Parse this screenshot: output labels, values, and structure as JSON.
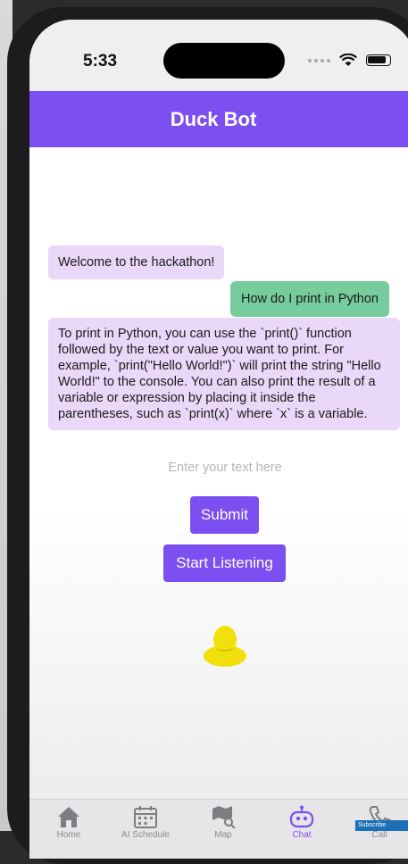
{
  "statusbar": {
    "time": "5:33"
  },
  "header": {
    "title": "Duck Bot"
  },
  "colors": {
    "accent": "#7b4ff0",
    "bot_bubble": "#e9d8f7",
    "user_bubble": "#76cc9c"
  },
  "messages": [
    {
      "role": "bot",
      "text": "Welcome to the hackathon!"
    },
    {
      "role": "user",
      "text": "How do I print in Python"
    },
    {
      "role": "bot",
      "text": "To print in Python, you can use the `print()` function followed by the text or value you want to print. For example, `print(\"Hello World!\")` will print the string \"Hello World!\" to the console. You can also print the result of a variable or expression by placing it inside the parentheses, such as `print(x)` where `x` is a variable."
    }
  ],
  "input": {
    "placeholder": "Enter your text here",
    "value": ""
  },
  "buttons": {
    "submit": "Submit",
    "listen": "Start Listening"
  },
  "tabs": [
    {
      "label": "Home",
      "icon": "home-icon"
    },
    {
      "label": "AI Schedule",
      "icon": "calendar-icon"
    },
    {
      "label": "Map",
      "icon": "map-icon"
    },
    {
      "label": "Chat",
      "icon": "robot-icon",
      "active": true
    },
    {
      "label": "Call",
      "icon": "phone-icon"
    }
  ],
  "overlay": {
    "subscribe": "Subscribe"
  }
}
